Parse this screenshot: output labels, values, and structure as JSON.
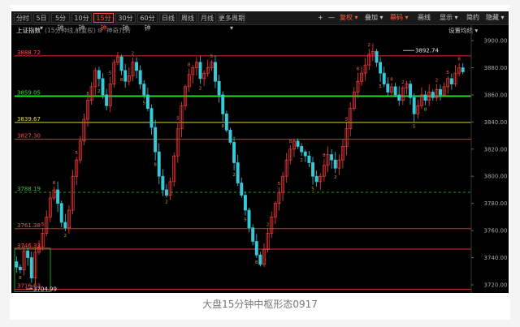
{
  "toolbar": {
    "tabs": [
      {
        "label": "分时",
        "active": false
      },
      {
        "label": "5日 ▾",
        "active": false
      },
      {
        "label": "5分钟",
        "active": false
      },
      {
        "label": "10分钟",
        "active": false
      },
      {
        "label": "15分钟",
        "active": true
      },
      {
        "label": "30分钟",
        "active": false
      },
      {
        "label": "60分钟",
        "active": false
      },
      {
        "label": "日线",
        "active": false
      },
      {
        "label": "周线",
        "active": false
      },
      {
        "label": "月线",
        "active": false
      },
      {
        "label": "更多周期 ▾",
        "active": false
      }
    ],
    "tools": {
      "plus": "+",
      "minus": "—",
      "fuquan": "复权 ▾",
      "diejia": "叠加 ▾",
      "tool1": "幕码 ▾",
      "huaxian": "画线",
      "xianshi": "显示 ▾",
      "jianyue": "简约",
      "yincang": "隐藏 ▾"
    },
    "accent": "#ff4b3e"
  },
  "subheader": {
    "index_name": "上证指数",
    "period_info": "(15分钟线,前复权)",
    "indicator": "神奇九转",
    "settings": "设置均线 ▾"
  },
  "chart_data": {
    "type": "candlestick",
    "y_ticks": [
      3720,
      3740,
      3760,
      3780,
      3800,
      3820,
      3840,
      3860,
      3880,
      3900
    ],
    "y_tick_labels": [
      "3720.00",
      "3740.00",
      "3760.00",
      "3780.00",
      "3800.00",
      "3820.00",
      "3840.00",
      "3860.00",
      "3880.00",
      "3900.00"
    ],
    "ylim": [
      3714,
      3912
    ],
    "levels": [
      {
        "label": "3888.72",
        "value": 3888.72,
        "color": "#e03030",
        "style": "solid"
      },
      {
        "label": "3859.05",
        "value": 3859.05,
        "color": "#22dd22",
        "style": "bold"
      },
      {
        "label": "3839.67",
        "value": 3839.67,
        "color": "#d8d040",
        "style": "solid"
      },
      {
        "label": "3827.30",
        "value": 3827.3,
        "color": "#e03030",
        "style": "solid"
      },
      {
        "label": "3788.19",
        "value": 3788.19,
        "color": "#229922",
        "style": "dashed"
      },
      {
        "label": "3761.38",
        "value": 3761.38,
        "color": "#e03030",
        "style": "solid"
      },
      {
        "label": "3746.33",
        "value": 3746.33,
        "color": "#e03030",
        "style": "solid"
      },
      {
        "label": "3716.63",
        "value": 3716.63,
        "color": "#e03030",
        "style": "solid"
      }
    ],
    "annotations": [
      {
        "label": "3892.74",
        "value": 3892.74,
        "position": "top"
      },
      {
        "label": "3704.99",
        "value": 3704.99,
        "position": "bottom-left"
      }
    ],
    "path": [
      3733,
      3731,
      3745,
      3740,
      3725,
      3744,
      3748,
      3758,
      3770,
      3784,
      3790,
      3780,
      3766,
      3762,
      3775,
      3800,
      3812,
      3826,
      3842,
      3856,
      3866,
      3878,
      3872,
      3860,
      3852,
      3868,
      3884,
      3888,
      3878,
      3870,
      3874,
      3884,
      3878,
      3868,
      3860,
      3850,
      3836,
      3818,
      3800,
      3790,
      3786,
      3796,
      3815,
      3835,
      3852,
      3866,
      3875,
      3880,
      3884,
      3872,
      3876,
      3880,
      3884,
      3870,
      3860,
      3846,
      3834,
      3825,
      3810,
      3795,
      3786,
      3775,
      3762,
      3752,
      3742,
      3735,
      3746,
      3758,
      3770,
      3780,
      3788,
      3800,
      3812,
      3820,
      3826,
      3822,
      3818,
      3815,
      3810,
      3800,
      3796,
      3800,
      3808,
      3816,
      3812,
      3806,
      3812,
      3822,
      3835,
      3850,
      3862,
      3870,
      3876,
      3882,
      3890,
      3892,
      3884,
      3876,
      3868,
      3862,
      3866,
      3860,
      3856,
      3865,
      3868,
      3858,
      3846,
      3852,
      3860,
      3856,
      3862,
      3858,
      3864,
      3860,
      3866,
      3872,
      3868,
      3876,
      3880,
      3877
    ]
  },
  "caption": "大盘15分钟中枢形态0917"
}
